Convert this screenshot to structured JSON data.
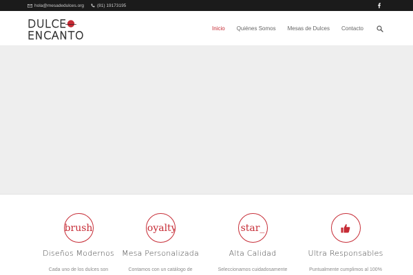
{
  "topbar": {
    "email": "hola@mesadedulces.org",
    "phone": "(81) 19173195",
    "social": "facebook-icon"
  },
  "logo": {
    "line1": "DULCE",
    "line2": "ENCANTO"
  },
  "nav": {
    "items": [
      "Inicio",
      "Quiénes Somos",
      "Mesas de Dulces",
      "Contacto"
    ],
    "active": "Inicio"
  },
  "colors": {
    "accent": "#c62b35",
    "topbar_bg": "#1b1b1b",
    "hero_bg": "#eeeeee"
  },
  "features": [
    {
      "icon_text": "brush",
      "title": "Diseños Modernos",
      "desc": "Cada uno de los dulces son"
    },
    {
      "icon_text": "loyalty",
      "title": "Mesa Personalizada",
      "desc": "Contamos con un catálogo de"
    },
    {
      "icon_text": "star_",
      "title": "Alta Calidad",
      "desc": "Seleccionamos cuidadosamente"
    },
    {
      "icon_text": "",
      "icon": "thumbs-up-icon",
      "title": "Ultra Responsables",
      "desc": "Puntualmente cumplimos al 100%"
    }
  ]
}
